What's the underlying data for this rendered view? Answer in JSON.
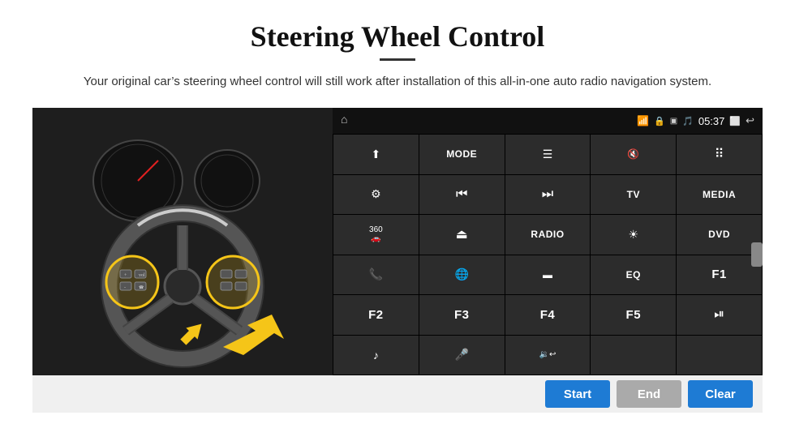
{
  "header": {
    "title": "Steering Wheel Control",
    "subtitle": "Your original car’s steering wheel control will still work after installation of this all-in-one auto radio navigation system."
  },
  "status_bar": {
    "time": "05:37",
    "home_icon": "⌂"
  },
  "grid_buttons": [
    {
      "row": 1,
      "col": 1,
      "type": "icon",
      "content": "↑",
      "label": "navigate-up"
    },
    {
      "row": 1,
      "col": 2,
      "type": "text",
      "content": "MODE",
      "label": "mode"
    },
    {
      "row": 1,
      "col": 3,
      "type": "icon",
      "content": "☰",
      "label": "menu"
    },
    {
      "row": 1,
      "col": 4,
      "type": "icon",
      "content": "🔇✕",
      "label": "mute"
    },
    {
      "row": 1,
      "col": 5,
      "type": "icon",
      "content": "…",
      "label": "apps"
    },
    {
      "row": 2,
      "col": 1,
      "type": "icon",
      "content": "☉",
      "label": "settings"
    },
    {
      "row": 2,
      "col": 2,
      "type": "icon",
      "content": "⏮",
      "label": "prev"
    },
    {
      "row": 2,
      "col": 3,
      "type": "icon",
      "content": "⏭",
      "label": "next"
    },
    {
      "row": 2,
      "col": 4,
      "type": "text",
      "content": "TV",
      "label": "tv"
    },
    {
      "row": 2,
      "col": 5,
      "type": "text",
      "content": "MEDIA",
      "label": "media"
    },
    {
      "row": 3,
      "col": 1,
      "type": "icon",
      "content": "🚗",
      "label": "360-cam"
    },
    {
      "row": 3,
      "col": 2,
      "type": "icon",
      "content": "⏫",
      "label": "eject"
    },
    {
      "row": 3,
      "col": 3,
      "type": "text",
      "content": "RADIO",
      "label": "radio"
    },
    {
      "row": 3,
      "col": 4,
      "type": "icon",
      "content": "☀",
      "label": "brightness"
    },
    {
      "row": 3,
      "col": 5,
      "type": "text",
      "content": "DVD",
      "label": "dvd"
    },
    {
      "row": 4,
      "col": 1,
      "type": "icon",
      "content": "📞",
      "label": "phone"
    },
    {
      "row": 4,
      "col": 2,
      "type": "icon",
      "content": "➿",
      "label": "navigation"
    },
    {
      "row": 4,
      "col": 3,
      "type": "icon",
      "content": "⬛",
      "label": "screen"
    },
    {
      "row": 4,
      "col": 4,
      "type": "text",
      "content": "EQ",
      "label": "eq"
    },
    {
      "row": 4,
      "col": 5,
      "type": "text",
      "content": "F1",
      "label": "f1"
    },
    {
      "row": 5,
      "col": 1,
      "type": "text",
      "content": "F2",
      "label": "f2"
    },
    {
      "row": 5,
      "col": 2,
      "type": "text",
      "content": "F3",
      "label": "f3"
    },
    {
      "row": 5,
      "col": 3,
      "type": "text",
      "content": "F4",
      "label": "f4"
    },
    {
      "row": 5,
      "col": 4,
      "type": "text",
      "content": "F5",
      "label": "f5"
    },
    {
      "row": 5,
      "col": 5,
      "type": "icon",
      "content": "⏯",
      "label": "play-pause"
    },
    {
      "row": 6,
      "col": 1,
      "type": "icon",
      "content": "♫",
      "label": "music"
    },
    {
      "row": 6,
      "col": 2,
      "type": "icon",
      "content": "🎤",
      "label": "mic"
    },
    {
      "row": 6,
      "col": 3,
      "type": "icon",
      "content": "🔇↪",
      "label": "volume-call"
    },
    {
      "row": 6,
      "col": 4,
      "type": "empty",
      "content": "",
      "label": "empty1"
    },
    {
      "row": 6,
      "col": 5,
      "type": "empty",
      "content": "",
      "label": "empty2"
    }
  ],
  "bottom_buttons": {
    "start_label": "Start",
    "end_label": "End",
    "clear_label": "Clear"
  },
  "colors": {
    "accent_blue": "#1e7bd4",
    "screen_bg": "#1a1a1a",
    "status_bg": "#111111",
    "button_bg": "#2c2c2c",
    "grid_gap": "#000000"
  }
}
